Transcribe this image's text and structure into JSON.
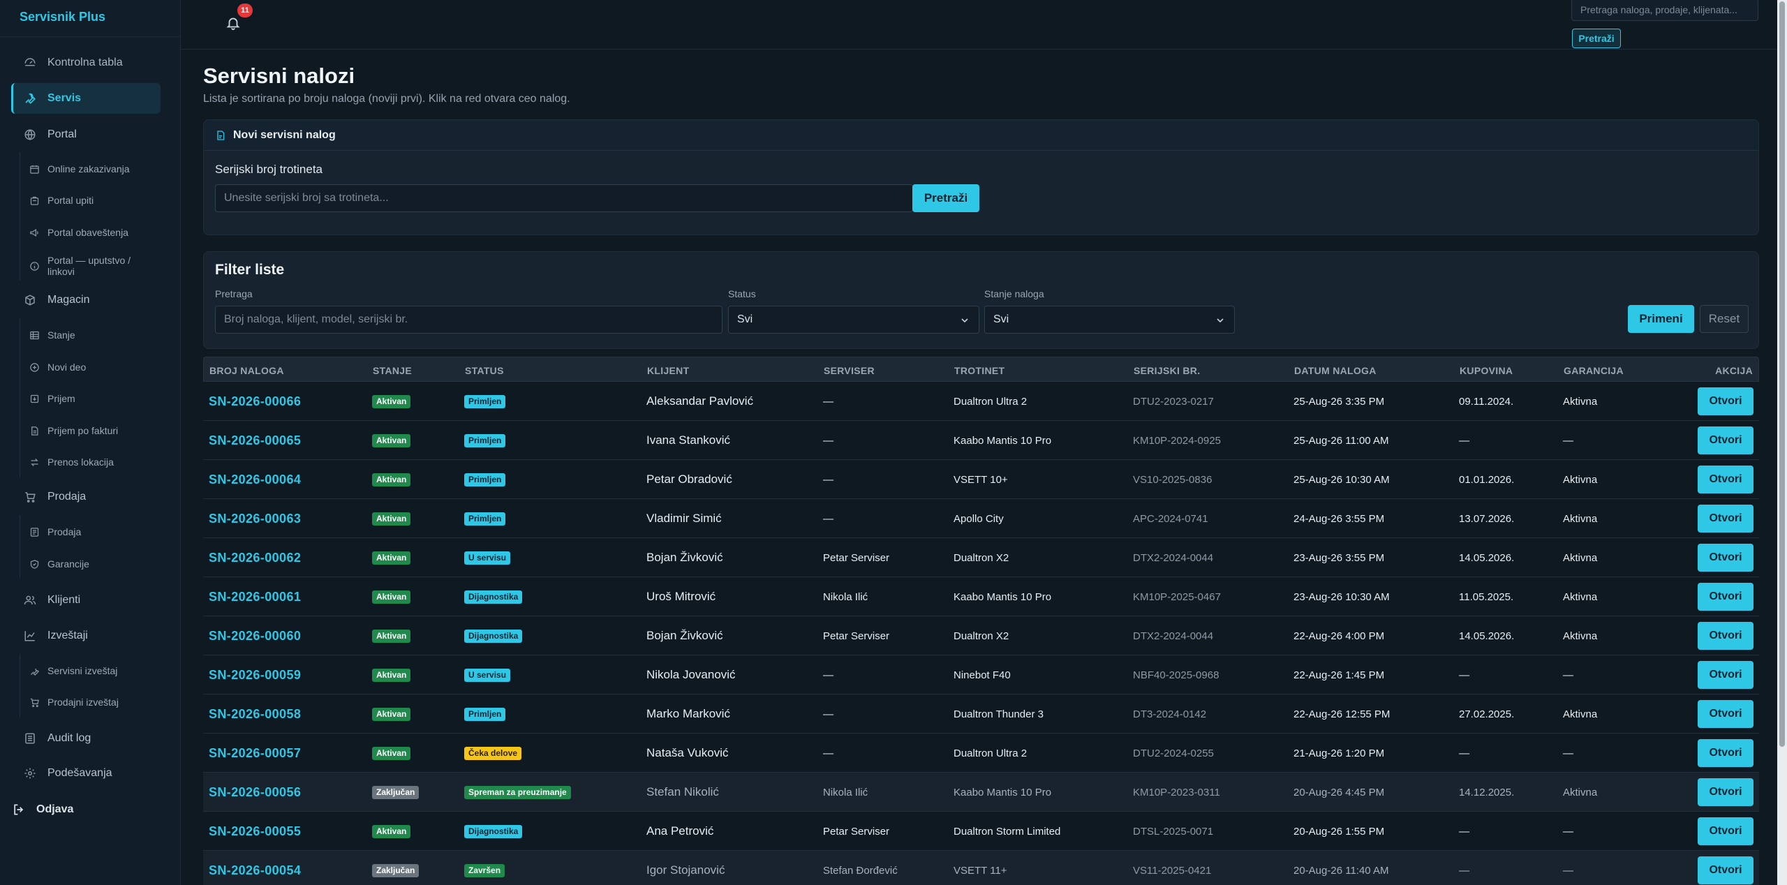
{
  "app": {
    "brand": "Servisnik Plus"
  },
  "sidebar": {
    "items": [
      {
        "label": "Kontrolna tabla",
        "icon": "dashboard-icon"
      },
      {
        "label": "Servis",
        "icon": "wrench-icon",
        "active": true
      },
      {
        "label": "Portal",
        "icon": "globe-icon"
      },
      {
        "label": "Magacin",
        "icon": "box-icon"
      },
      {
        "label": "Prodaja",
        "icon": "cart-icon"
      },
      {
        "label": "Klijenti",
        "icon": "users-icon"
      },
      {
        "label": "Izveštaji",
        "icon": "chart-icon"
      },
      {
        "label": "Audit log",
        "icon": "log-icon"
      },
      {
        "label": "Podešavanja",
        "icon": "gear-icon"
      },
      {
        "label": "Odjava",
        "icon": "logout-icon"
      }
    ],
    "portal_sub": [
      {
        "label": "Online zakazivanja",
        "icon": "calendar-icon"
      },
      {
        "label": "Portal upiti",
        "icon": "inbox-icon"
      },
      {
        "label": "Portal obaveštenja",
        "icon": "megaphone-icon"
      },
      {
        "label": "Portal — uputstvo / linkovi",
        "icon": "info-icon"
      }
    ],
    "magacin_sub": [
      {
        "label": "Stanje",
        "icon": "table-icon"
      },
      {
        "label": "Novi deo",
        "icon": "plus-circle-icon"
      },
      {
        "label": "Prijem",
        "icon": "receive-icon"
      },
      {
        "label": "Prijem po fakturi",
        "icon": "invoice-icon"
      },
      {
        "label": "Prenos lokacija",
        "icon": "transfer-icon"
      }
    ],
    "prodaja_sub": [
      {
        "label": "Prodaja",
        "icon": "document-icon"
      },
      {
        "label": "Garancije",
        "icon": "shield-icon"
      }
    ],
    "izvestaji_sub": [
      {
        "label": "Servisni izveštaj",
        "icon": "wrench-icon"
      },
      {
        "label": "Prodajni izveštaj",
        "icon": "cart-icon"
      }
    ]
  },
  "topbar": {
    "notifications_count": "11",
    "search_placeholder": "Pretraga naloga, prodaje, klijenata...",
    "search_button": "Pretraži"
  },
  "page": {
    "title": "Servisni nalozi",
    "subtitle": "Lista je sortirana po broju naloga (noviji prvi). Klik na red otvara ceo nalog."
  },
  "new_order": {
    "title": "Novi servisni nalog",
    "serial_label": "Serijski broj trotineta",
    "serial_placeholder": "Unesite serijski broj sa trotineta...",
    "search_button": "Pretraži"
  },
  "filter": {
    "title": "Filter liste",
    "search_label": "Pretraga",
    "search_placeholder": "Broj naloga, klijent, model, serijski br.",
    "status_label": "Status",
    "status_value": "Svi",
    "state_label": "Stanje naloga",
    "state_value": "Svi",
    "apply_button": "Primeni",
    "reset_button": "Reset"
  },
  "table": {
    "headers": [
      "BROJ NALOGA",
      "STANJE",
      "STATUS",
      "KLIJENT",
      "SERVISER",
      "TROTINET",
      "SERIJSKI BR.",
      "DATUM NALOGA",
      "KUPOVINA",
      "GARANCIJA",
      "AKCIJA"
    ],
    "action_label": "Otvori",
    "rows": [
      {
        "num": "SN-2026-00066",
        "state": "Aktivan",
        "status": "Primljen",
        "status_kind": "primljen",
        "client": "Aleksandar Pavlović",
        "serviser": "—",
        "scooter": "Dualtron Ultra 2",
        "serial": "DTU2-2023-0217",
        "date": "25-Aug-26 3:35 PM",
        "purchase": "09.11.2024.",
        "warranty": "Aktivna"
      },
      {
        "num": "SN-2026-00065",
        "state": "Aktivan",
        "status": "Primljen",
        "status_kind": "primljen",
        "client": "Ivana Stanković",
        "serviser": "—",
        "scooter": "Kaabo Mantis 10 Pro",
        "serial": "KM10P-2024-0925",
        "date": "25-Aug-26 11:00 AM",
        "purchase": "—",
        "warranty": "—"
      },
      {
        "num": "SN-2026-00064",
        "state": "Aktivan",
        "status": "Primljen",
        "status_kind": "primljen",
        "client": "Petar Obradović",
        "serviser": "—",
        "scooter": "VSETT 10+",
        "serial": "VS10-2025-0836",
        "date": "25-Aug-26 10:30 AM",
        "purchase": "01.01.2026.",
        "warranty": "Aktivna"
      },
      {
        "num": "SN-2026-00063",
        "state": "Aktivan",
        "status": "Primljen",
        "status_kind": "primljen",
        "client": "Vladimir Simić",
        "serviser": "—",
        "scooter": "Apollo City",
        "serial": "APC-2024-0741",
        "date": "24-Aug-26 3:55 PM",
        "purchase": "13.07.2026.",
        "warranty": "Aktivna"
      },
      {
        "num": "SN-2026-00062",
        "state": "Aktivan",
        "status": "U servisu",
        "status_kind": "uservisu",
        "client": "Bojan Živković",
        "serviser": "Petar Serviser",
        "scooter": "Dualtron X2",
        "serial": "DTX2-2024-0044",
        "date": "23-Aug-26 3:55 PM",
        "purchase": "14.05.2026.",
        "warranty": "Aktivna"
      },
      {
        "num": "SN-2026-00061",
        "state": "Aktivan",
        "status": "Dijagnostika",
        "status_kind": "dijag",
        "client": "Uroš Mitrović",
        "serviser": "Nikola Ilić",
        "scooter": "Kaabo Mantis 10 Pro",
        "serial": "KM10P-2025-0467",
        "date": "23-Aug-26 10:30 AM",
        "purchase": "11.05.2025.",
        "warranty": "Aktivna"
      },
      {
        "num": "SN-2026-00060",
        "state": "Aktivan",
        "status": "Dijagnostika",
        "status_kind": "dijag",
        "client": "Bojan Živković",
        "serviser": "Petar Serviser",
        "scooter": "Dualtron X2",
        "serial": "DTX2-2024-0044",
        "date": "22-Aug-26 4:00 PM",
        "purchase": "14.05.2026.",
        "warranty": "Aktivna"
      },
      {
        "num": "SN-2026-00059",
        "state": "Aktivan",
        "status": "U servisu",
        "status_kind": "uservisu",
        "client": "Nikola Jovanović",
        "serviser": "—",
        "scooter": "Ninebot F40",
        "serial": "NBF40-2025-0968",
        "date": "22-Aug-26 1:45 PM",
        "purchase": "—",
        "warranty": "—"
      },
      {
        "num": "SN-2026-00058",
        "state": "Aktivan",
        "status": "Primljen",
        "status_kind": "primljen",
        "client": "Marko Marković",
        "serviser": "—",
        "scooter": "Dualtron Thunder 3",
        "serial": "DT3-2024-0142",
        "date": "22-Aug-26 12:55 PM",
        "purchase": "27.02.2025.",
        "warranty": "Aktivna"
      },
      {
        "num": "SN-2026-00057",
        "state": "Aktivan",
        "status": "Čeka delove",
        "status_kind": "ceka",
        "client": "Nataša Vuković",
        "serviser": "—",
        "scooter": "Dualtron Ultra 2",
        "serial": "DTU2-2024-0255",
        "date": "21-Aug-26 1:20 PM",
        "purchase": "—",
        "warranty": "—"
      },
      {
        "num": "SN-2026-00056",
        "state": "Zaključan",
        "status": "Spreman za preuzimanje",
        "status_kind": "spreman",
        "client": "Stefan Nikolić",
        "serviser": "Nikola Ilić",
        "scooter": "Kaabo Mantis 10 Pro",
        "serial": "KM10P-2023-0311",
        "date": "20-Aug-26 4:45 PM",
        "purchase": "14.12.2025.",
        "warranty": "Aktivna"
      },
      {
        "num": "SN-2026-00055",
        "state": "Aktivan",
        "status": "Dijagnostika",
        "status_kind": "dijag",
        "client": "Ana Petrović",
        "serviser": "Petar Serviser",
        "scooter": "Dualtron Storm Limited",
        "serial": "DTSL-2025-0071",
        "date": "20-Aug-26 1:55 PM",
        "purchase": "—",
        "warranty": "—"
      },
      {
        "num": "SN-2026-00054",
        "state": "Zaključan",
        "status": "Završen",
        "status_kind": "zavrsen",
        "client": "Igor Stojanović",
        "serviser": "Stefan Đorđević",
        "scooter": "VSETT 11+",
        "serial": "VS11-2025-0421",
        "date": "20-Aug-26 11:40 AM",
        "purchase": "—",
        "warranty": "—"
      }
    ]
  }
}
